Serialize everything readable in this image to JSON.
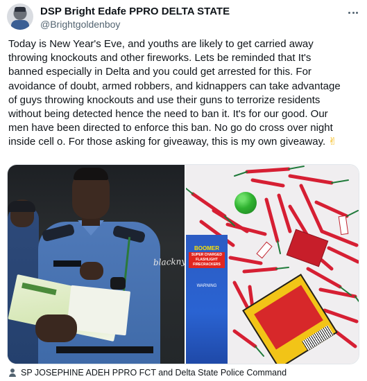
{
  "tweet": {
    "author_name": "DSP Bright Edafe PPRO DELTA STATE",
    "author_handle": "@Brightgoldenboy",
    "text_lines": [
      "Today is New Year's Eve, and youths are likely to get carried away",
      "throwing knockouts and other fireworks. Lets be reminded that It's",
      "banned especially in Delta and you could get arrested for this. For",
      "avoidance of doubt, armed robbers, and kidnappers can take advantage",
      "of guys throwing knockouts and use their guns to terrorize residents",
      "without being detected hence the need to ban it. It's for our good. Our",
      "men have been directed to enforce this ban. No go do cross over night",
      "inside cell o.  For those asking for giveaway, this is my own giveaway."
    ],
    "emoji": "✌",
    "left_photo_watermark": "blacknyc",
    "firework_box_blue": {
      "brand": "BOOMER",
      "label": "SUPER CHARGED FLASHLIGHT FIRECRACKERS",
      "warning": "WARNING"
    },
    "media_caption": "SP JOSEPHINE ADEH PPRO FCT and Delta State Police Command",
    "colors": {
      "text": "#0f1419",
      "secondary": "#536471",
      "firecracker_red": "#d61f33",
      "fuse_green": "#1f7a3a",
      "box_blue": "#2a63d2",
      "box_yellow": "#f2c417"
    },
    "icons": {
      "more": "more-horizontal-icon",
      "caption": "person-icon"
    }
  }
}
